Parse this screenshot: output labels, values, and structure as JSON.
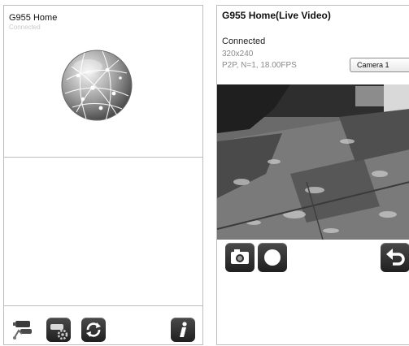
{
  "left_panel": {
    "title": "G955 Home",
    "status": "Connected",
    "icons": {
      "connect": "cameras-link-icon",
      "settings": "camera-settings-icon",
      "refresh": "refresh-icon",
      "info": "info-icon",
      "globe": "globe-icon"
    }
  },
  "right_panel": {
    "title": "G955 Home(Live Video)",
    "status": "Connected",
    "resolution": "320x240",
    "stream_info": "P2P, N=1, 18.00FPS",
    "camera_select": {
      "selected": "Camera 1"
    },
    "icons": {
      "snapshot": "camera-snapshot-icon",
      "record": "record-icon",
      "back": "back-arrow-icon"
    }
  },
  "colors": {
    "icon_dark": "#2b2b2b",
    "divider": "#bdbdbd",
    "status_grey": "#8a8a8a"
  }
}
